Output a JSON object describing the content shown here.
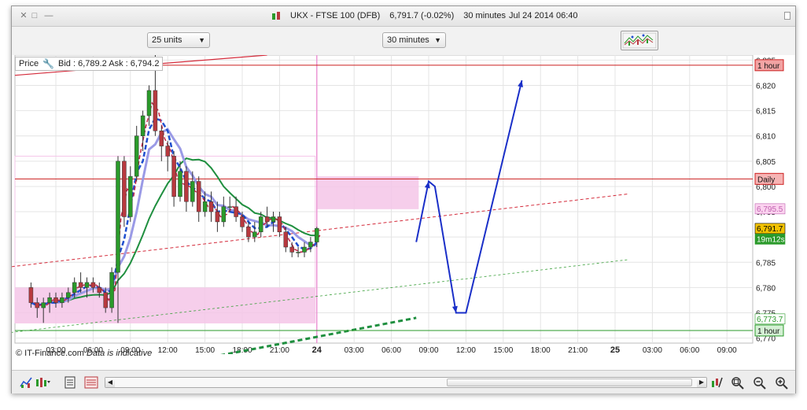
{
  "window": {
    "title_instrument": "UKX - FTSE 100 (DFB)",
    "title_price": "6,791.7 (-0.02%)",
    "title_interval": "30 minutes",
    "title_datetime": "Jul 24 2014 06:40"
  },
  "toolbar": {
    "units_select": "25 units",
    "interval_select": "30 minutes"
  },
  "chart_info": {
    "price_label": "Price",
    "bid_ask": "Bid : 6,789.2 Ask : 6,794.2",
    "copyright": "© IT-Finance.com",
    "disclaimer": "Data is indicative"
  },
  "chart_data": {
    "type": "candlestick",
    "ylim": [
      6769,
      6826
    ],
    "y_ticks": [
      "6,825",
      "6,820",
      "6,815",
      "6,810",
      "6,805",
      "6,800",
      "6,795",
      "6,790",
      "6,785",
      "6,780",
      "6,775",
      "6,770"
    ],
    "y_tick_values": [
      6825,
      6820,
      6815,
      6810,
      6805,
      6800,
      6795,
      6790,
      6785,
      6780,
      6775,
      6770
    ],
    "x_ticks": [
      "03:00",
      "06:00",
      "09:00",
      "12:00",
      "15:00",
      "18:00",
      "21:00",
      "24",
      "03:00",
      "06:00",
      "09:00",
      "12:00",
      "15:00",
      "18:00",
      "21:00",
      "25",
      "03:00",
      "06:00",
      "09:00"
    ],
    "x_tick_bold": [
      false,
      false,
      false,
      false,
      false,
      false,
      false,
      true,
      false,
      false,
      false,
      false,
      false,
      false,
      false,
      true,
      false,
      false,
      false
    ],
    "candles": [
      [
        6780,
        6781,
        6776,
        6777
      ],
      [
        6777,
        6778,
        6774,
        6776
      ],
      [
        6776,
        6778,
        6773,
        6777
      ],
      [
        6777,
        6779,
        6775,
        6778
      ],
      [
        6778,
        6779,
        6776,
        6777
      ],
      [
        6777,
        6779,
        6776,
        6778
      ],
      [
        6778,
        6780,
        6777,
        6779
      ],
      [
        6779,
        6782,
        6778,
        6781
      ],
      [
        6781,
        6783,
        6779,
        6780
      ],
      [
        6780,
        6782,
        6778,
        6781
      ],
      [
        6781,
        6782,
        6779,
        6780
      ],
      [
        6780,
        6781,
        6778,
        6779
      ],
      [
        6779,
        6780,
        6775,
        6776
      ],
      [
        6776,
        6784,
        6775,
        6783
      ],
      [
        6783,
        6806,
        6773,
        6805
      ],
      [
        6805,
        6806,
        6792,
        6794
      ],
      [
        6794,
        6804,
        6793,
        6802
      ],
      [
        6802,
        6812,
        6801,
        6810
      ],
      [
        6810,
        6815,
        6807,
        6814
      ],
      [
        6814,
        6820,
        6812,
        6819
      ],
      [
        6819,
        6826,
        6810,
        6811
      ],
      [
        6811,
        6812,
        6805,
        6808
      ],
      [
        6808,
        6809,
        6803,
        6806
      ],
      [
        6806,
        6807,
        6796,
        6798
      ],
      [
        6798,
        6805,
        6797,
        6803
      ],
      [
        6803,
        6804,
        6795,
        6797
      ],
      [
        6797,
        6803,
        6796,
        6801
      ],
      [
        6801,
        6802,
        6793,
        6795
      ],
      [
        6795,
        6799,
        6794,
        6797
      ],
      [
        6797,
        6799,
        6793,
        6795
      ],
      [
        6795,
        6797,
        6791,
        6793
      ],
      [
        6793,
        6798,
        6792,
        6796
      ],
      [
        6796,
        6798,
        6795,
        6796
      ],
      [
        6796,
        6798,
        6793,
        6794
      ],
      [
        6794,
        6795,
        6791,
        6792
      ],
      [
        6792,
        6793,
        6789,
        6790
      ],
      [
        6790,
        6793,
        6789,
        6791
      ],
      [
        6791,
        6795,
        6790,
        6794
      ],
      [
        6794,
        6796,
        6792,
        6793
      ],
      [
        6793,
        6795,
        6791,
        6794
      ],
      [
        6794,
        6795,
        6790,
        6791
      ],
      [
        6791,
        6792,
        6787,
        6788
      ],
      [
        6788,
        6789,
        6786,
        6787
      ],
      [
        6787,
        6788,
        6786,
        6787
      ],
      [
        6787,
        6789,
        6786,
        6788
      ],
      [
        6788,
        6790,
        6787,
        6789
      ],
      [
        6789,
        6792,
        6788,
        6791.7
      ]
    ],
    "candle_start_hour": 1.0,
    "candle_step_hours": 0.5,
    "horizontal_lines": [
      {
        "label": "1 hour",
        "value": 6824,
        "color": "#cc1f1f"
      },
      {
        "label": "Daily",
        "value": 6801.5,
        "color": "#cc1f1f"
      },
      {
        "label": "1 hour",
        "value": 6771.5,
        "color": "#2a9a2a"
      }
    ],
    "price_tags": [
      {
        "text": "6,795.5",
        "value": 6795.5,
        "bg": "#fbd3ef",
        "fg": "#c060b0"
      },
      {
        "text": "6,791.7",
        "value": 6791.6,
        "bg": "#f2c200",
        "fg": "#000000"
      },
      {
        "text": "19m12s",
        "value": 6789.5,
        "bg": "#2a9a2a",
        "fg": "#ffffff"
      },
      {
        "text": "6,773.7",
        "value": 6773.7,
        "bg": "#ffffff",
        "fg": "#2a9a2a"
      }
    ],
    "trend_red": [
      [
        -1.0,
        6784
      ],
      [
        49.0,
        6798.5
      ]
    ],
    "trend_green": [
      [
        -1.0,
        6771
      ],
      [
        49.0,
        6785.5
      ]
    ],
    "forecast_arrow": [
      [
        32.0,
        6789
      ],
      [
        33.0,
        6801
      ],
      [
        33.5,
        6800
      ],
      [
        35.2,
        6775
      ],
      [
        36.0,
        6775
      ],
      [
        40.5,
        6821
      ]
    ],
    "colors": {
      "up": "#2a9a2a",
      "down": "#b8393f",
      "ma_blue": "#1f4fcf",
      "ma_lavender": "#9a9ae6",
      "ma_green": "#1f8f3f",
      "pink": "#f5c6e8",
      "arrow": "#1a2fc8"
    }
  },
  "bottombar": {
    "icons": [
      "chart-type-icon",
      "indicator-icon",
      "notepad-icon",
      "compare-icon",
      "scroll-left-icon",
      "scroll-right-icon",
      "tools-icon",
      "zoom-fit-icon",
      "zoom-out-icon",
      "zoom-in-icon"
    ]
  }
}
